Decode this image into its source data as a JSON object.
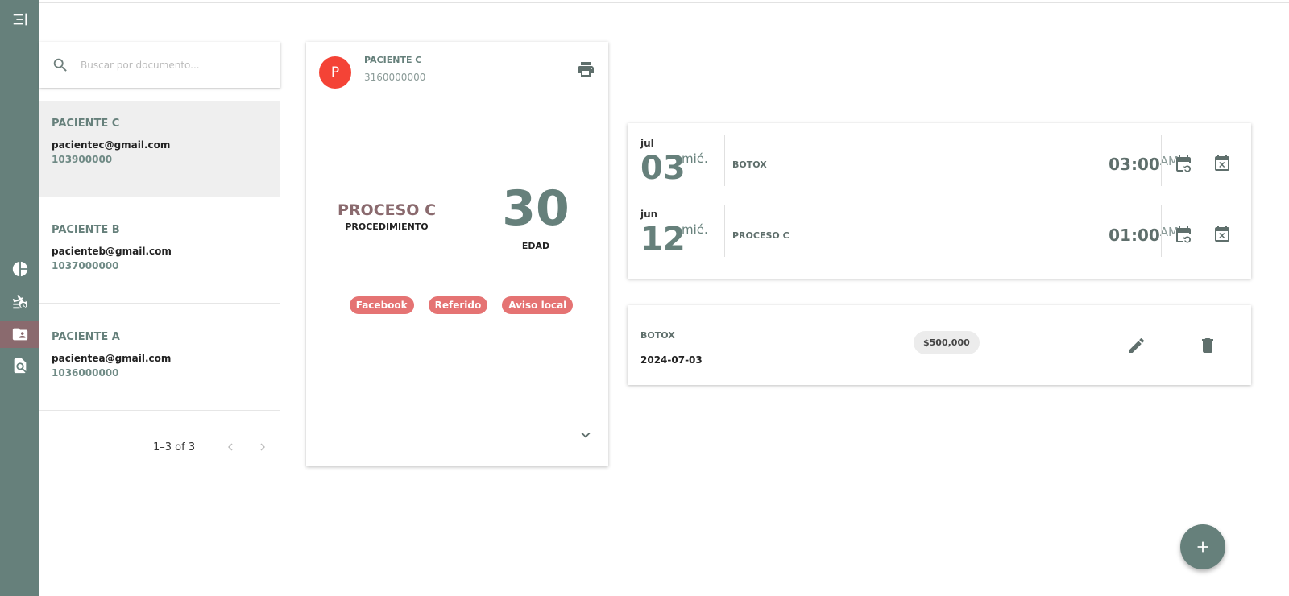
{
  "sidebar": {
    "icons": [
      "menu-collapse-icon",
      "pie-chart-icon",
      "flight-schedule-icon",
      "contact-folder-icon",
      "document-search-icon"
    ],
    "active_index": 3,
    "colors": {
      "background": "#66807b",
      "active": "#8a6a6e"
    }
  },
  "search": {
    "placeholder": "Buscar por documento..."
  },
  "patients": [
    {
      "name": "PACIENTE C",
      "email": "pacientec@gmail.com",
      "document": "103900000",
      "selected": true
    },
    {
      "name": "PACIENTE B",
      "email": "pacienteb@gmail.com",
      "document": "1037000000",
      "selected": false
    },
    {
      "name": "PACIENTE A",
      "email": "pacientea@gmail.com",
      "document": "1036000000",
      "selected": false
    }
  ],
  "pagination": {
    "range": "1–3 of 3"
  },
  "detail": {
    "avatar_letter": "P",
    "name": "PACIENTE C",
    "phone": "3160000000",
    "procedure": "PROCESO C",
    "procedure_label": "PROCEDIMIENTO",
    "age": "30",
    "age_label": "EDAD",
    "tags": [
      "Facebook",
      "Referido",
      "Aviso local"
    ]
  },
  "appointments": [
    {
      "month": "jul",
      "day": "03",
      "weekday": "mié.",
      "procedure": "BOTOX",
      "time": "03:00",
      "ampm": "AM"
    },
    {
      "month": "jun",
      "day": "12",
      "weekday": "mié.",
      "procedure": "PROCESO C",
      "time": "01:00",
      "ampm": "AM"
    }
  ],
  "payment": {
    "procedure": "BOTOX",
    "date": "2024-07-03",
    "amount": "$500,000"
  },
  "colors": {
    "primary": "#66807b",
    "accent": "#8a6a6e",
    "avatar": "#f44336",
    "tag": "#e57373"
  }
}
